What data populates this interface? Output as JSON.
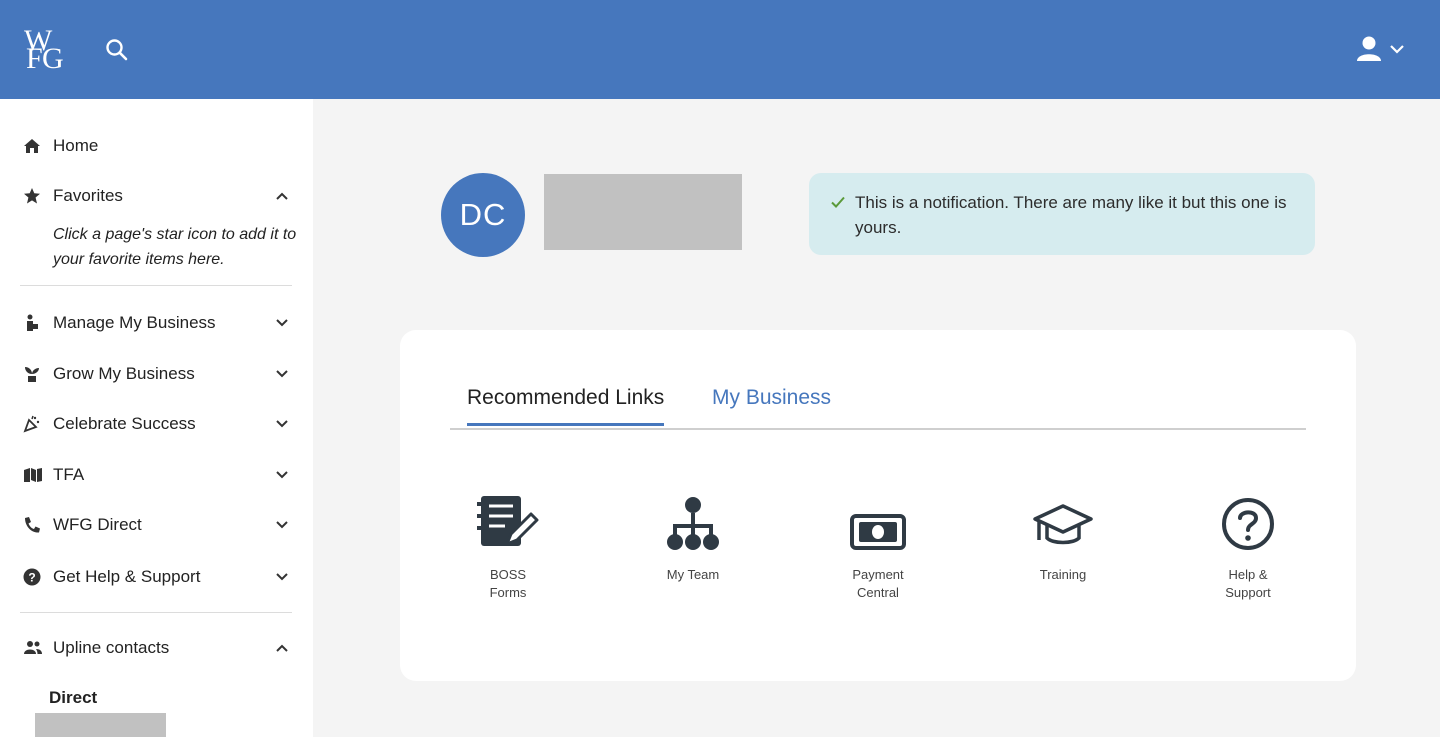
{
  "header": {
    "logo_alt": "WFG",
    "search_icon": "search-icon",
    "user_icon": "user-icon"
  },
  "sidebar": {
    "items": [
      {
        "label": "Home",
        "icon": "home-icon"
      },
      {
        "label": "Favorites",
        "icon": "star-icon"
      },
      {
        "label": "Manage My Business",
        "icon": "person-briefcase-icon"
      },
      {
        "label": "Grow My Business",
        "icon": "plant-icon"
      },
      {
        "label": "Celebrate Success",
        "icon": "party-popper-icon"
      },
      {
        "label": "TFA",
        "icon": "flag-icon"
      },
      {
        "label": "WFG Direct",
        "icon": "phone-icon"
      },
      {
        "label": "Get Help & Support",
        "icon": "help-circle-icon"
      },
      {
        "label": "Upline contacts",
        "icon": "people-icon"
      }
    ],
    "favorites_hint": "Click a page's star icon to add it to your favorite items here.",
    "direct_label": "Direct"
  },
  "profile": {
    "initials": "DC"
  },
  "notification": {
    "text": "This is a notification. There are many like it but this one is yours."
  },
  "tabs": [
    {
      "label": "Recommended Links",
      "active": true
    },
    {
      "label": "My Business",
      "active": false
    }
  ],
  "links": [
    {
      "label": "BOSS Forms",
      "icon": "document-edit-icon"
    },
    {
      "label": "My Team",
      "icon": "org-chart-icon"
    },
    {
      "label": "Payment Central",
      "icon": "money-bill-icon"
    },
    {
      "label": "Training",
      "icon": "graduation-cap-icon"
    },
    {
      "label": "Help & Support",
      "icon": "question-circle-icon"
    }
  ],
  "colors": {
    "brand": "#4677bd",
    "notice_bg": "#d6ecef",
    "check": "#5a9a3a"
  }
}
